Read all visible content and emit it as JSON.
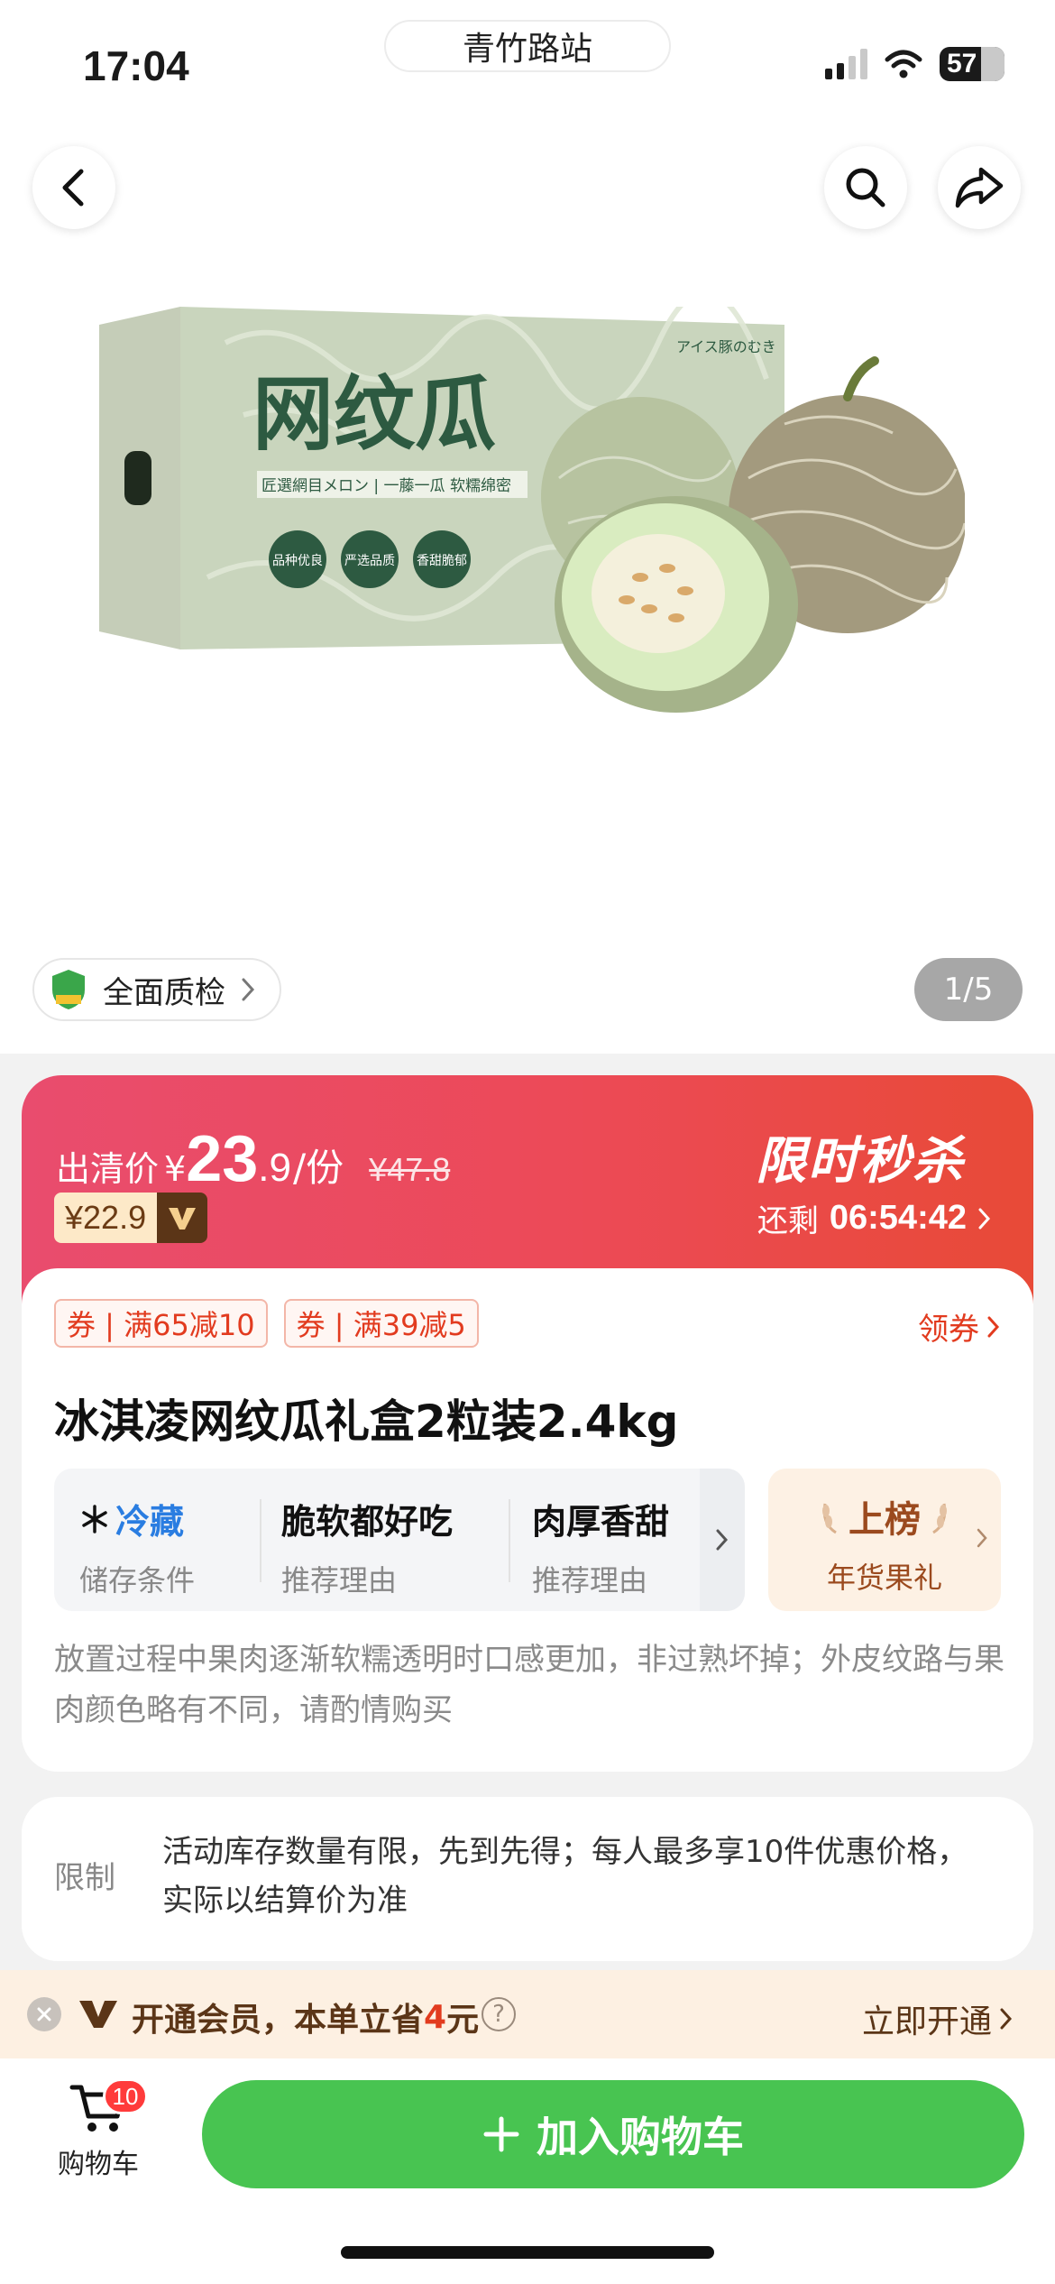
{
  "status_bar": {
    "time": "17:04",
    "location": "青竹路站",
    "battery": "57"
  },
  "nav": {
    "back_icon": "chevron-left-icon",
    "search_icon": "search-icon",
    "share_icon": "share-icon"
  },
  "product_image": {
    "box_title": "网纹瓜",
    "box_subtitle": "匠選網目メロン | 一藤一瓜 软糯绵密",
    "box_japanese": "アイス豚のむき",
    "badges": [
      "品种优良",
      "严选品质",
      "香甜脆郁"
    ]
  },
  "quality": {
    "label": "全面质检"
  },
  "pager": {
    "text": "1/5"
  },
  "promo": {
    "price_label": "出清价",
    "currency": "¥",
    "price_int": "23",
    "price_dec": ".9",
    "unit": "/份",
    "original_price": "¥47.8",
    "vip_price": "¥22.9",
    "flash_title": "限时秒杀",
    "countdown_label": "还剩",
    "countdown_time": "06:54:42"
  },
  "card": {
    "coupons": [
      "券 | 满65减10",
      "券 | 满39减5"
    ],
    "get_coupon": "领券",
    "title": "冰淇凌网纹瓜礼盒2粒装2.4kg",
    "attrs": [
      {
        "value": "冷藏",
        "key": "储存条件"
      },
      {
        "value": "脆软都好吃",
        "key": "推荐理由"
      },
      {
        "value": "肉厚香甜",
        "key": "推荐理由"
      }
    ],
    "rank": {
      "value": "上榜",
      "key": "年货果礼"
    },
    "description": "放置过程中果肉逐渐软糯透明时口感更加，非过熟坏掉；外皮纹路与果肉颜色略有不同，请酌情购买"
  },
  "limit": {
    "label": "限制",
    "text": "活动库存数量有限，先到先得；每人最多享10件优惠价格，实际以结算价为准"
  },
  "member_bar": {
    "text_prefix": "开通会员，本单立省",
    "amount": "4",
    "text_suffix": "元",
    "action": "立即开通"
  },
  "bottom": {
    "cart_label": "购物车",
    "cart_count": "10",
    "add_to_cart": "加入购物车"
  },
  "colors": {
    "accent_green": "#48c451",
    "promo_red": "#ec4a57",
    "coupon_red": "#e23b1f",
    "member_brown": "#5b3517"
  }
}
